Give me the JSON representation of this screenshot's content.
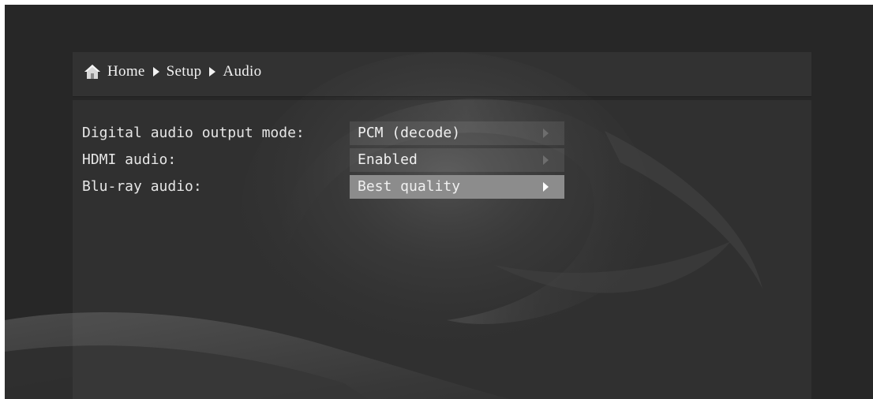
{
  "breadcrumb": {
    "icon": "home-icon",
    "items": [
      "Home",
      "Setup",
      "Audio"
    ]
  },
  "settings": [
    {
      "label": "Digital audio output mode:",
      "value": "PCM (decode)",
      "selected": false
    },
    {
      "label": "HDMI audio:",
      "value": "Enabled",
      "selected": false
    },
    {
      "label": "Blu-ray audio:",
      "value": "Best quality",
      "selected": true
    }
  ],
  "colors": {
    "background": "#262626",
    "selected_row": "#8c8c8c",
    "text": "#f0f0f0"
  }
}
